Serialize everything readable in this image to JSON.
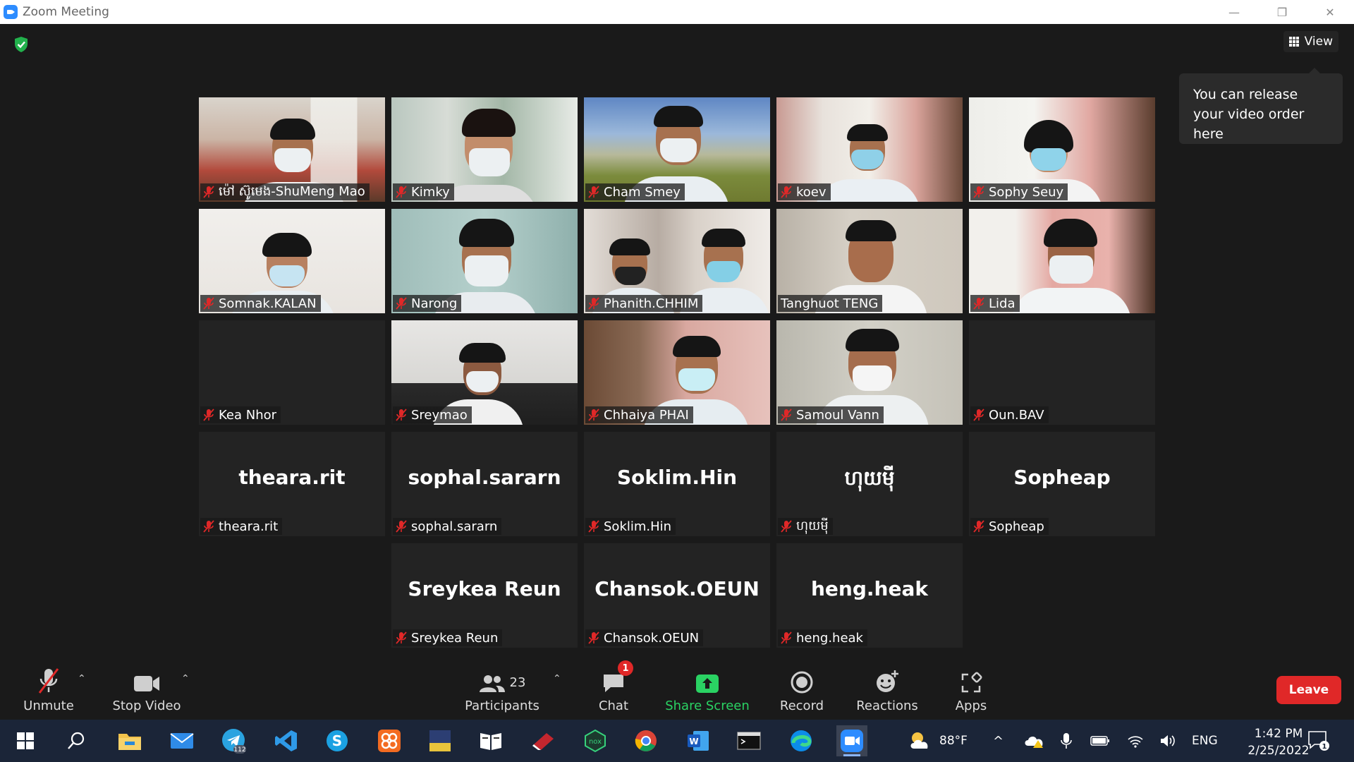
{
  "window": {
    "title": "Zoom Meeting",
    "minimize": "—",
    "restore": "❐",
    "close": "✕"
  },
  "topbar": {
    "view_label": "View",
    "tooltip": "You can release your video order here"
  },
  "participants": [
    {
      "name": "ម៉ៅ ស៊ូមេង-ShuMeng Mao",
      "video": true,
      "muted": true
    },
    {
      "name": "Kimky",
      "video": true,
      "muted": true
    },
    {
      "name": "Cham Smey",
      "video": true,
      "muted": true
    },
    {
      "name": "koev",
      "video": true,
      "muted": true
    },
    {
      "name": "Sophy Seuy",
      "video": true,
      "muted": true
    },
    {
      "name": "Somnak.KALAN",
      "video": true,
      "muted": true
    },
    {
      "name": "Narong",
      "video": true,
      "muted": true
    },
    {
      "name": "Phanith.CHHIM",
      "video": true,
      "muted": true
    },
    {
      "name": "Tanghuot TENG",
      "video": true,
      "muted": false,
      "speaking": true
    },
    {
      "name": "Lida",
      "video": true,
      "muted": true
    },
    {
      "name": "Kea Nhor",
      "video": false,
      "muted": true
    },
    {
      "name": "Sreymao",
      "video": true,
      "muted": true
    },
    {
      "name": "Chhaiya PHAI",
      "video": true,
      "muted": true
    },
    {
      "name": "Samoul Vann",
      "video": true,
      "muted": true
    },
    {
      "name": "Oun.BAV",
      "video": false,
      "muted": true
    },
    {
      "name": "theara.rit",
      "video": false,
      "muted": true,
      "display": "theara.rit"
    },
    {
      "name": "sophal.sararn",
      "video": false,
      "muted": true,
      "display": "sophal.sararn"
    },
    {
      "name": "Soklim.Hin",
      "video": false,
      "muted": true,
      "display": "Soklim.Hin"
    },
    {
      "name": "ហុយមុី",
      "video": false,
      "muted": true,
      "display": "ហុយមុី"
    },
    {
      "name": "Sopheap",
      "video": false,
      "muted": true,
      "display": "Sopheap"
    },
    {
      "name": "Sreykea Reun",
      "video": false,
      "muted": true,
      "display": "Sreykea Reun"
    },
    {
      "name": "Chansok.OEUN",
      "video": false,
      "muted": true,
      "display": "Chansok.OEUN"
    },
    {
      "name": "heng.heak",
      "video": false,
      "muted": true,
      "display": "heng.heak"
    }
  ],
  "toolbar": {
    "unmute": "Unmute",
    "stop_video": "Stop Video",
    "participants": "Participants",
    "participants_count": "23",
    "chat": "Chat",
    "chat_badge": "1",
    "share_screen": "Share Screen",
    "record": "Record",
    "reactions": "Reactions",
    "apps": "Apps",
    "leave": "Leave"
  },
  "taskbar": {
    "telegram_badge": "112",
    "weather": "88°F",
    "language": "ENG",
    "time": "1:42 PM",
    "date": "2/25/2022",
    "notifications": "1"
  },
  "colors": {
    "accent": "#2d8cff",
    "speaking_border": "#d9e58a",
    "leave": "#e02828",
    "share": "#2ad263"
  }
}
